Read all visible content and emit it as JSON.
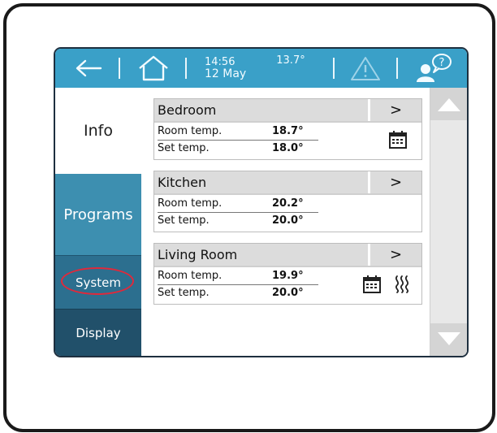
{
  "topbar": {
    "time": "14:56",
    "date": "12 May",
    "outdoor_temp": "13.7°"
  },
  "sidebar": {
    "items": [
      {
        "label": "Info"
      },
      {
        "label": "Programs"
      },
      {
        "label": "System"
      },
      {
        "label": "Display"
      }
    ]
  },
  "rooms": [
    {
      "name": "Bedroom",
      "room_temp_label": "Room temp.",
      "room_temp": "18.7°",
      "set_temp_label": "Set temp.",
      "set_temp": "18.0°",
      "icons": [
        "calendar-icon"
      ]
    },
    {
      "name": "Kitchen",
      "room_temp_label": "Room temp.",
      "room_temp": "20.2°",
      "set_temp_label": "Set temp.",
      "set_temp": "20.0°",
      "icons": []
    },
    {
      "name": "Living Room",
      "room_temp_label": "Room temp.",
      "room_temp": "19.9°",
      "set_temp_label": "Set temp.",
      "set_temp": "20.0°",
      "icons": [
        "calendar-icon",
        "heating-icon"
      ]
    }
  ],
  "arrow_glyph": ">",
  "colors": {
    "topbar": "#3aa0c8",
    "programs": "#3d8fb0",
    "system": "#2c6f8f",
    "display": "#21506a",
    "highlight_circle": "#e0293b"
  }
}
